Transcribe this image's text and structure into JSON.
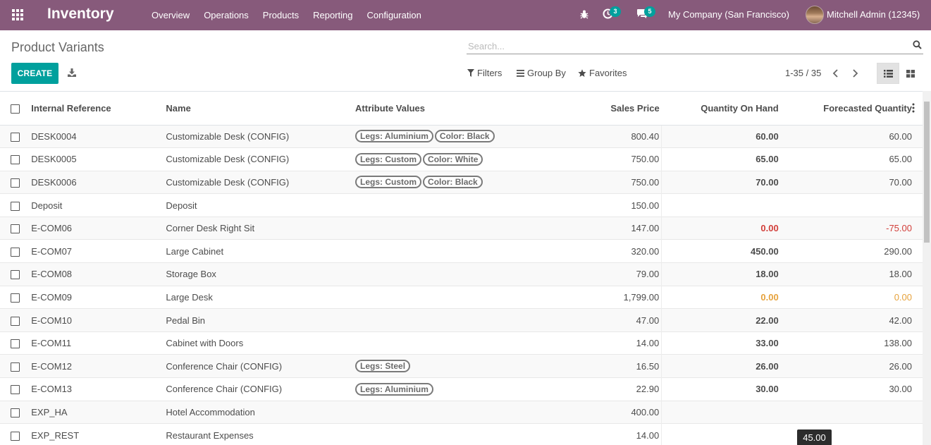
{
  "navbar": {
    "app_name": "Inventory",
    "menu": [
      "Overview",
      "Operations",
      "Products",
      "Reporting",
      "Configuration"
    ],
    "activity_count": "3",
    "messages_count": "5",
    "company": "My Company (San Francisco)",
    "user": "Mitchell Admin (12345)",
    "color": "#875a7b"
  },
  "control_panel": {
    "title": "Product Variants",
    "search_placeholder": "Search...",
    "create_label": "CREATE",
    "filters_label": "Filters",
    "group_by_label": "Group By",
    "favorites_label": "Favorites",
    "pager": "1-35 / 35",
    "accent_color": "#00a09d"
  },
  "table": {
    "columns": [
      "Internal Reference",
      "Name",
      "Attribute Values",
      "Sales Price",
      "Quantity On Hand",
      "Forecasted Quantity"
    ],
    "rows": [
      {
        "ref": "DESK0004",
        "name": "Customizable Desk (CONFIG)",
        "attrs": [
          "Legs: Aluminium",
          "Color: Black"
        ],
        "price": "800.40",
        "qty": "60.00",
        "qty_state": "normal",
        "forecast": "60.00",
        "forecast_state": "normal"
      },
      {
        "ref": "DESK0005",
        "name": "Customizable Desk (CONFIG)",
        "attrs": [
          "Legs: Custom",
          "Color: White"
        ],
        "price": "750.00",
        "qty": "65.00",
        "qty_state": "normal",
        "forecast": "65.00",
        "forecast_state": "normal"
      },
      {
        "ref": "DESK0006",
        "name": "Customizable Desk (CONFIG)",
        "attrs": [
          "Legs: Custom",
          "Color: Black"
        ],
        "price": "750.00",
        "qty": "70.00",
        "qty_state": "normal",
        "forecast": "70.00",
        "forecast_state": "normal"
      },
      {
        "ref": "Deposit",
        "name": "Deposit",
        "attrs": [],
        "price": "150.00",
        "qty": "",
        "qty_state": "normal",
        "forecast": "",
        "forecast_state": "normal"
      },
      {
        "ref": "E-COM06",
        "name": "Corner Desk Right Sit",
        "attrs": [],
        "price": "147.00",
        "qty": "0.00",
        "qty_state": "red",
        "forecast": "-75.00",
        "forecast_state": "red"
      },
      {
        "ref": "E-COM07",
        "name": "Large Cabinet",
        "attrs": [],
        "price": "320.00",
        "qty": "450.00",
        "qty_state": "normal",
        "forecast": "290.00",
        "forecast_state": "normal"
      },
      {
        "ref": "E-COM08",
        "name": "Storage Box",
        "attrs": [],
        "price": "79.00",
        "qty": "18.00",
        "qty_state": "normal",
        "forecast": "18.00",
        "forecast_state": "normal"
      },
      {
        "ref": "E-COM09",
        "name": "Large Desk",
        "attrs": [],
        "price": "1,799.00",
        "qty": "0.00",
        "qty_state": "orange",
        "forecast": "0.00",
        "forecast_state": "orange"
      },
      {
        "ref": "E-COM10",
        "name": "Pedal Bin",
        "attrs": [],
        "price": "47.00",
        "qty": "22.00",
        "qty_state": "normal",
        "forecast": "42.00",
        "forecast_state": "normal"
      },
      {
        "ref": "E-COM11",
        "name": "Cabinet with Doors",
        "attrs": [],
        "price": "14.00",
        "qty": "33.00",
        "qty_state": "normal",
        "forecast": "138.00",
        "forecast_state": "normal"
      },
      {
        "ref": "E-COM12",
        "name": "Conference Chair (CONFIG)",
        "attrs": [
          "Legs: Steel"
        ],
        "price": "16.50",
        "qty": "26.00",
        "qty_state": "normal",
        "forecast": "26.00",
        "forecast_state": "normal"
      },
      {
        "ref": "E-COM13",
        "name": "Conference Chair (CONFIG)",
        "attrs": [
          "Legs: Aluminium"
        ],
        "price": "22.90",
        "qty": "30.00",
        "qty_state": "normal",
        "forecast": "30.00",
        "forecast_state": "normal"
      },
      {
        "ref": "EXP_HA",
        "name": "Hotel Accommodation",
        "attrs": [],
        "price": "400.00",
        "qty": "",
        "qty_state": "normal",
        "forecast": "",
        "forecast_state": "normal"
      },
      {
        "ref": "EXP_REST",
        "name": "Restaurant Expenses",
        "attrs": [],
        "price": "14.00",
        "qty": "",
        "qty_state": "normal",
        "forecast": "",
        "forecast_state": "normal"
      }
    ]
  },
  "tooltip": "45.00"
}
